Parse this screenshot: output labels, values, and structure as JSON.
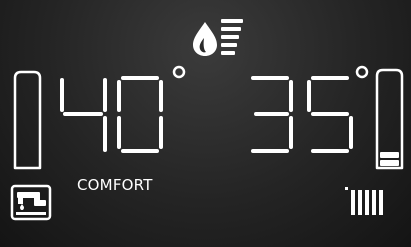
{
  "display": {
    "hot_water_temperature": "40",
    "heating_temperature": "35",
    "degree_symbol": "°",
    "mode_label": "COMFORT",
    "hot_water_level": 0.0,
    "heating_level": 0.2
  },
  "icons": {
    "flame": "flame-icon",
    "flame_intensity": "flame-intensity-bars-icon",
    "tap": "tap-icon",
    "radiator": "radiator-icon"
  },
  "colors": {
    "background": "#242424",
    "foreground": "#ffffff"
  }
}
